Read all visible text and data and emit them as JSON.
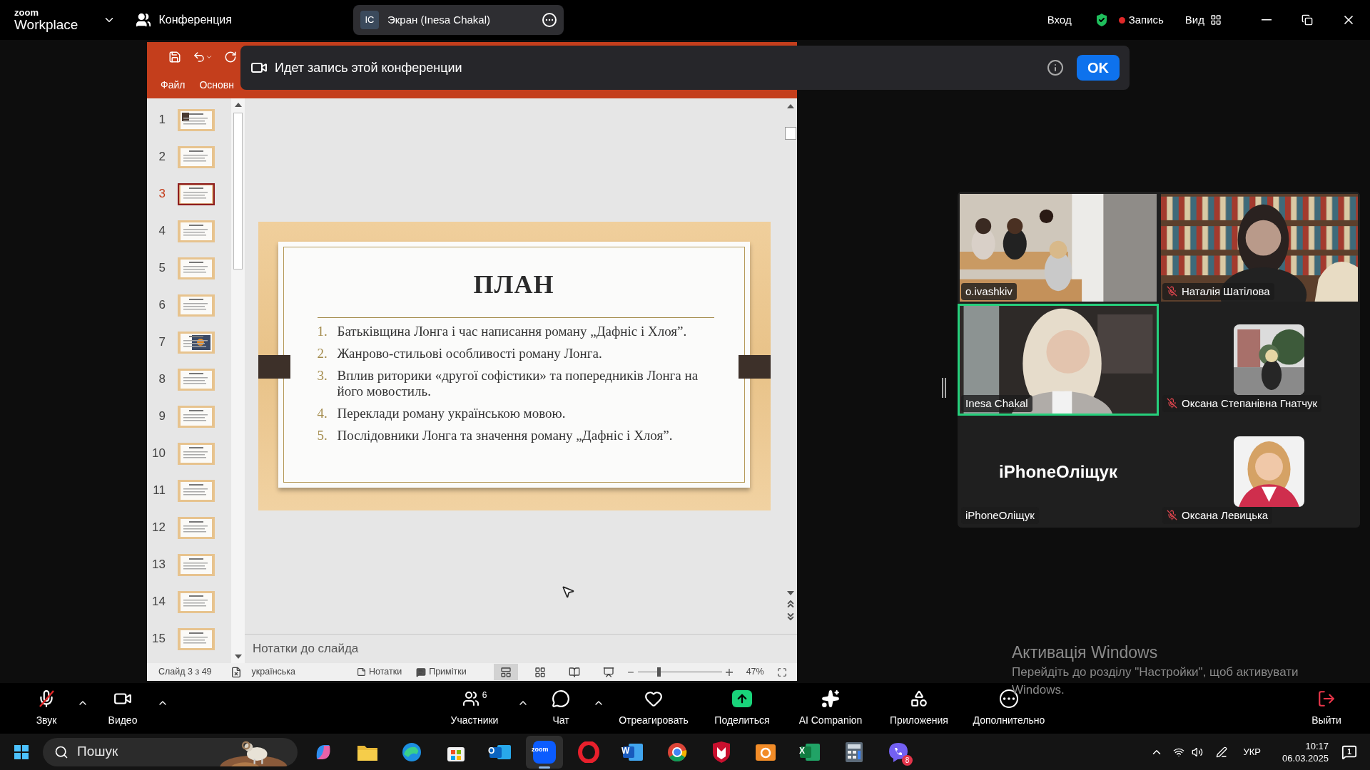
{
  "top_bar": {
    "logo_top": "zoom",
    "logo_bottom": "Workplace",
    "meeting_label": "Конференция",
    "share_pill": {
      "initials": "IC",
      "label": "Экран (Inesa Chakal)"
    },
    "sign_in": "Вход",
    "recording": "Запись",
    "view": "Вид"
  },
  "recording_banner": {
    "message": "Идет запись этой конференции",
    "button": "OK"
  },
  "presentation": {
    "ribbon_tabs": [
      "Файл",
      "Основн"
    ],
    "slides": [
      {
        "number": "1",
        "selected": false
      },
      {
        "number": "2",
        "selected": false
      },
      {
        "number": "3",
        "selected": true
      },
      {
        "number": "4",
        "selected": false
      },
      {
        "number": "5",
        "selected": false
      },
      {
        "number": "6",
        "selected": false
      },
      {
        "number": "7",
        "selected": false
      },
      {
        "number": "8",
        "selected": false
      },
      {
        "number": "9",
        "selected": false
      },
      {
        "number": "10",
        "selected": false
      },
      {
        "number": "11",
        "selected": false
      },
      {
        "number": "12",
        "selected": false
      },
      {
        "number": "13",
        "selected": false
      },
      {
        "number": "14",
        "selected": false
      },
      {
        "number": "15",
        "selected": false
      }
    ],
    "slide": {
      "title": "ПЛАН",
      "items": [
        {
          "number": "1.",
          "text": "Батьківщина Лонга і час написання роману „Дафніс і Хлоя”."
        },
        {
          "number": "2.",
          "text": "Жанрово-стильові особливості роману Лонга."
        },
        {
          "number": "3.",
          "text": "Вплив риторики «другої софістики» та попередників Лонга на його мовостиль."
        },
        {
          "number": "4.",
          "text": "Переклади роману українською мовою."
        },
        {
          "number": "5.",
          "text": "Послідовники Лонга та значення роману „Дафніс і Хлоя”."
        }
      ]
    },
    "notes_field": {
      "placeholder": "Нотатки до слайда"
    },
    "status_bar": {
      "slide_count": "Слайд 3 з 49",
      "language": "українська",
      "notes": "Нотатки",
      "comments": "Примітки",
      "views": [
        {
          "kind": "normal",
          "selected": true
        },
        {
          "kind": "sorter",
          "selected": false
        },
        {
          "kind": "reading",
          "selected": false
        },
        {
          "kind": "show",
          "selected": false
        }
      ],
      "zoom_slider": {
        "level": 0.25
      },
      "zoom": "47%"
    }
  },
  "participants": [
    {
      "name": "o.ivashkiv",
      "kind": "video",
      "muted": false,
      "speaking": false
    },
    {
      "name": "Наталія Шатілова",
      "kind": "video",
      "muted": true,
      "speaking": false
    },
    {
      "name": "Inesa Chakal",
      "kind": "video",
      "muted": false,
      "speaking": true
    },
    {
      "name": "Оксана Степанівна Гнатчук",
      "kind": "avatar",
      "muted": true,
      "speaking": false
    },
    {
      "name": "iPhoneОліщук",
      "kind": "name_only",
      "display_name": "iPhoneОліщук",
      "muted": false,
      "speaking": false
    },
    {
      "name": "Оксана Левицька",
      "kind": "avatar",
      "muted": true,
      "speaking": false
    }
  ],
  "activation": {
    "title": "Активація Windows",
    "message": "Перейдіть до розділу \"Настройки\", щоб активувати Windows."
  },
  "meeting_controls": [
    {
      "kind": "mic",
      "label": "Звук",
      "muted": true,
      "caret": true
    },
    {
      "kind": "camera",
      "label": "Видео",
      "caret": true
    },
    {
      "kind": "people",
      "label": "Участники",
      "count": "6",
      "caret": true
    },
    {
      "kind": "chat",
      "label": "Чат",
      "caret": true
    },
    {
      "kind": "heart",
      "label": "Отреагировать",
      "caret": false
    },
    {
      "kind": "share",
      "label": "Поделиться",
      "caret": false
    },
    {
      "kind": "sparkle",
      "label": "AI Companion",
      "caret": false
    },
    {
      "kind": "apps",
      "label": "Приложения",
      "caret": false
    },
    {
      "kind": "more",
      "label": "Дополнительно",
      "caret": false
    },
    {
      "kind": "leave",
      "label": "Выйти",
      "caret": false
    }
  ],
  "taskbar": {
    "search": {
      "placeholder": "Пошук"
    },
    "apps": [
      {
        "kind": "ribbon",
        "active": false
      },
      {
        "kind": "folder",
        "active": false
      },
      {
        "kind": "wave",
        "active": false
      },
      {
        "kind": "bag",
        "active": false
      },
      {
        "kind": "mail",
        "glyph": "O",
        "active": false
      },
      {
        "kind": "meeting",
        "glyph": "zoom",
        "active": true
      },
      {
        "kind": "ring",
        "active": false
      },
      {
        "kind": "document",
        "glyph": "W",
        "active": false
      },
      {
        "kind": "tricolor",
        "active": false
      },
      {
        "kind": "shield",
        "active": false
      },
      {
        "kind": "camera",
        "active": false
      },
      {
        "kind": "sheet",
        "glyph": "X",
        "active": false
      },
      {
        "kind": "calculator",
        "active": false
      },
      {
        "kind": "phone",
        "badge": "8",
        "active": false
      }
    ],
    "language": "УКР",
    "time": "10:17",
    "date": "06.03.2025",
    "notifications": "1"
  }
}
